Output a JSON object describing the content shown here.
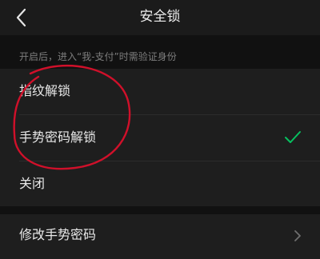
{
  "nav": {
    "title": "安全锁",
    "back_icon": "chevron-left-icon"
  },
  "lock_section": {
    "hint": "开启后，进入“我-支付”时需验证身份",
    "options": [
      {
        "label": "指纹解锁",
        "selected": false
      },
      {
        "label": "手势密码解锁",
        "selected": true
      },
      {
        "label": "关闭",
        "selected": false
      }
    ],
    "selected_icon": "checkmark-icon"
  },
  "gesture_section": {
    "change_password_label": "修改手势密码",
    "chevron_icon": "chevron-right-icon"
  },
  "colors": {
    "accent_check": "#07c160",
    "annotation": "#d0102a",
    "background": "#111111",
    "row_background": "#1e1e1e"
  }
}
